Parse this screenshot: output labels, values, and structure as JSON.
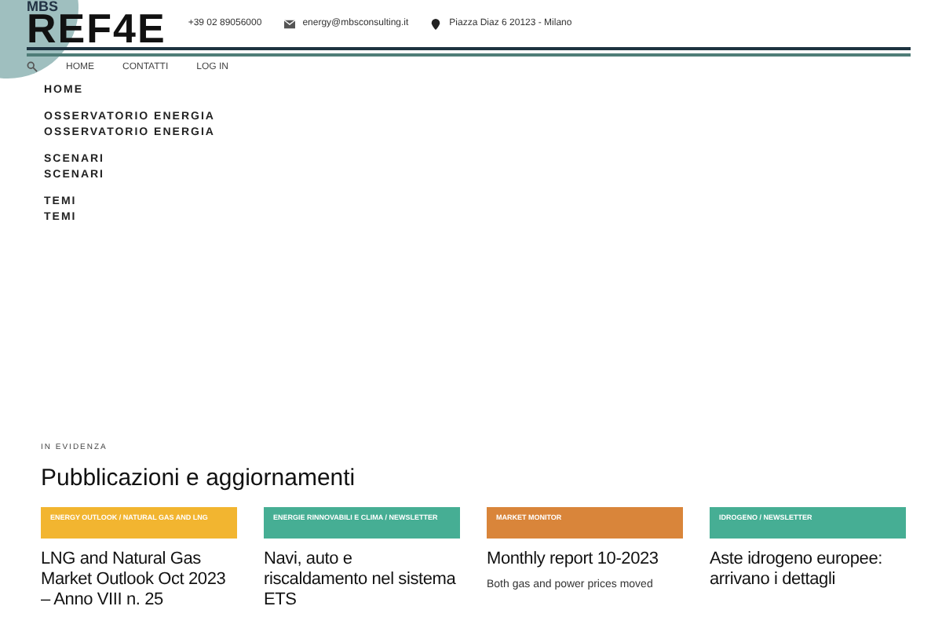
{
  "header": {
    "logo": "REF4E",
    "logo_small": "MBS",
    "phone": "+39 02 89056000",
    "email": "energy@mbsconsulting.it",
    "address": "Piazza Diaz 6 20123 - Milano"
  },
  "nav": [
    "HOME",
    "CONTATTI",
    "LOG IN"
  ],
  "menu": [
    "HOME",
    "OSSERVATORIO ENERGIA",
    "OSSERVATORIO ENERGIA",
    "SCENARI",
    "SCENARI",
    "TEMI",
    "TEMI"
  ],
  "section": {
    "eyebrow": "IN EVIDENZA",
    "title": "Pubblicazioni e aggiornamenti"
  },
  "cards": [
    {
      "tag": "ENERGY OUTLOOK / NATURAL GAS AND LNG",
      "color": "#f2b530",
      "title": "LNG and Natural Gas Market Outlook Oct 2023 – Anno VIII n. 25"
    },
    {
      "tag": "ENERGIE RINNOVABILI E CLIMA / NEWSLETTER",
      "color": "#46ae94",
      "title": "Navi, auto e riscaldamento nel sistema ETS"
    },
    {
      "tag": "MARKET MONITOR",
      "color": "#d9853a",
      "title": "Monthly report 10-2023",
      "excerpt": "Both gas and power prices moved"
    },
    {
      "tag": "IDROGENO / NEWSLETTER",
      "color": "#46ae94",
      "title": "Aste idrogeno europee: arrivano i dettagli"
    }
  ]
}
